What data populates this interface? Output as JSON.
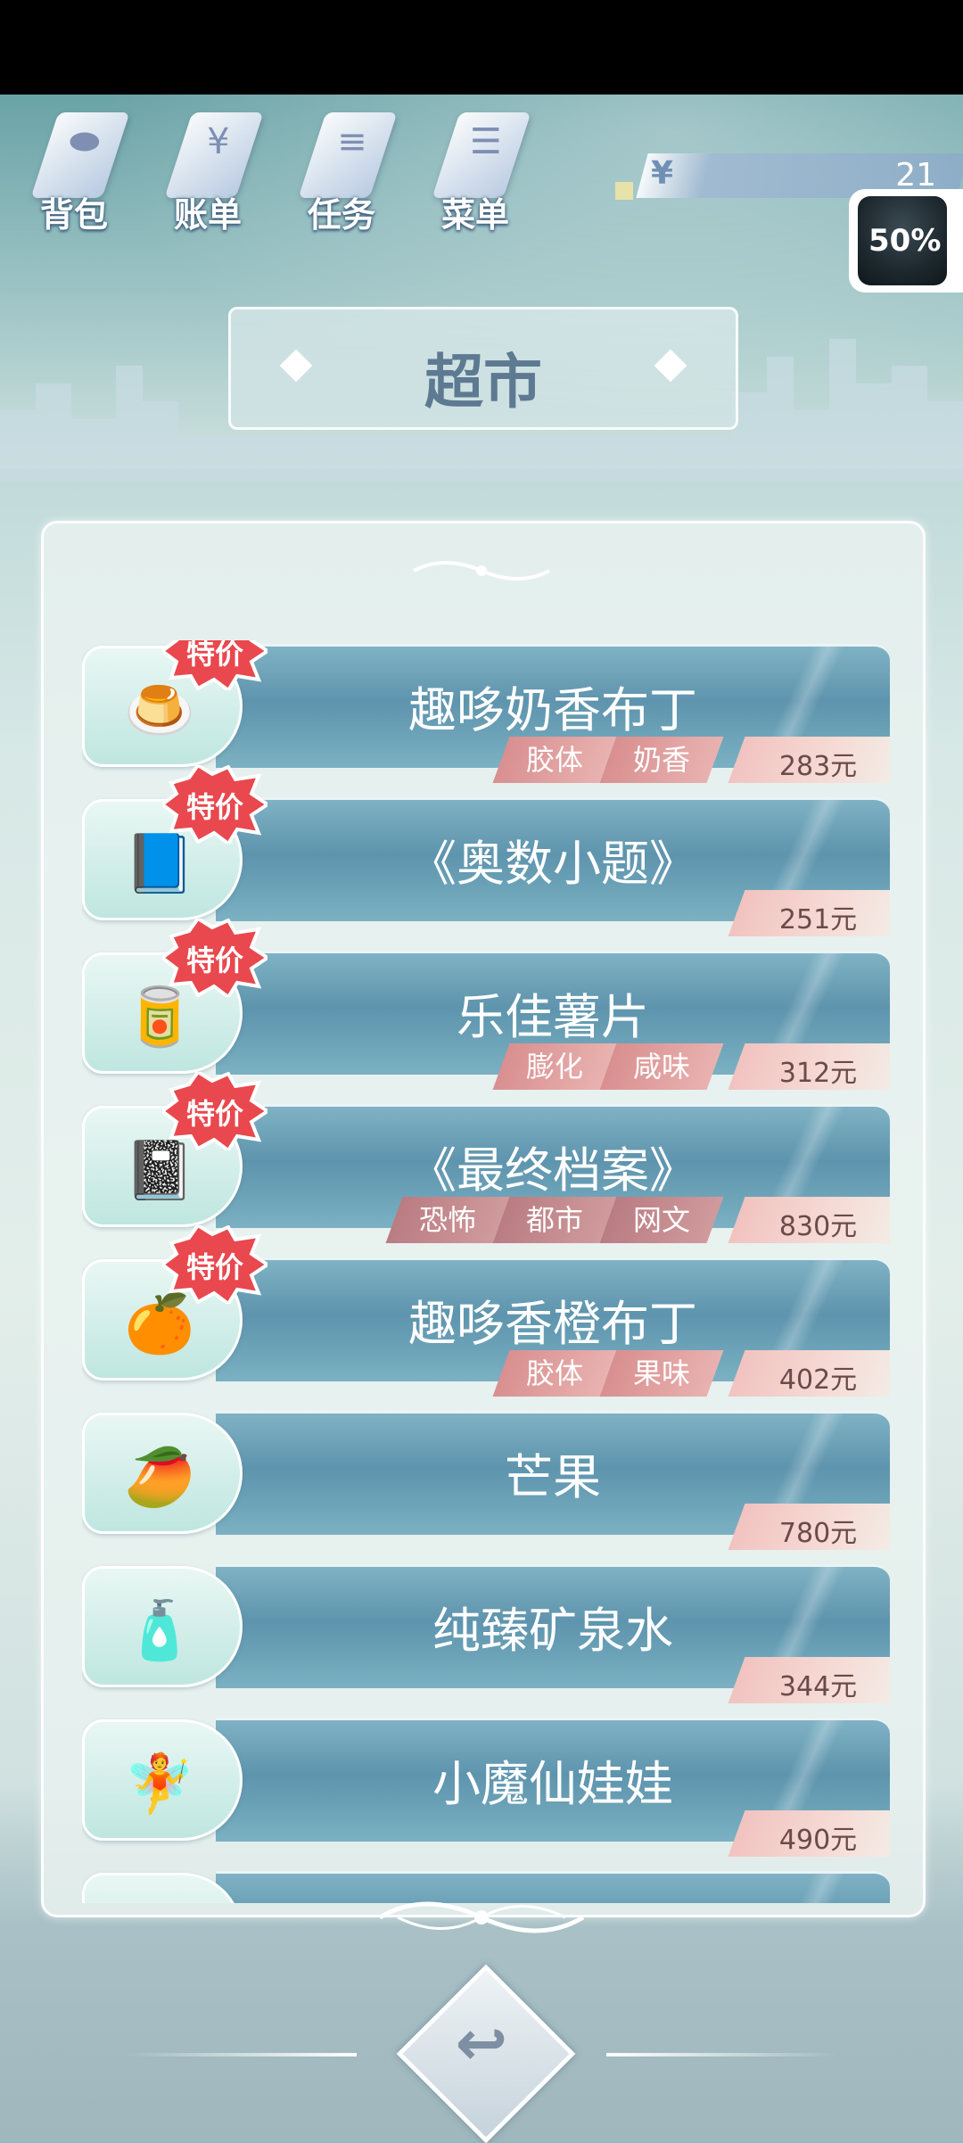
{
  "nav": [
    {
      "label": "背包",
      "icon": "bag-icon"
    },
    {
      "label": "账单",
      "icon": "bill-icon"
    },
    {
      "label": "任务",
      "icon": "task-icon"
    },
    {
      "label": "菜单",
      "icon": "menu-icon"
    }
  ],
  "money": {
    "symbol": "¥",
    "value": "21"
  },
  "avatar": {
    "percent": "50%"
  },
  "title": "超市",
  "sale_label": "特价",
  "items": [
    {
      "name": "趣哆奶香布丁",
      "price": "283元",
      "tags": [
        "胶体",
        "奶香"
      ],
      "sale": true,
      "icon": "pudding-icon"
    },
    {
      "name": "《奥数小题》",
      "price": "251元",
      "tags": [],
      "sale": true,
      "icon": "book-icon"
    },
    {
      "name": "乐佳薯片",
      "price": "312元",
      "tags": [
        "膨化",
        "咸味"
      ],
      "sale": true,
      "icon": "chips-icon"
    },
    {
      "name": "《最终档案》",
      "price": "830元",
      "tags": [
        "恐怖",
        "都市",
        "网文"
      ],
      "sale": true,
      "icon": "dark-book-icon"
    },
    {
      "name": "趣哆香橙布丁",
      "price": "402元",
      "tags": [
        "胶体",
        "果味"
      ],
      "sale": true,
      "icon": "orange-pudding-icon"
    },
    {
      "name": "芒果",
      "price": "780元",
      "tags": [],
      "sale": false,
      "icon": "mango-icon"
    },
    {
      "name": "纯臻矿泉水",
      "price": "344元",
      "tags": [],
      "sale": false,
      "icon": "water-bottle-icon"
    },
    {
      "name": "小魔仙娃娃",
      "price": "490元",
      "tags": [],
      "sale": false,
      "icon": "fairy-doll-icon"
    }
  ],
  "colors": {
    "accent": "#5e94ad",
    "sale": "#e8484e",
    "price_bg": "#f1c3c0"
  }
}
